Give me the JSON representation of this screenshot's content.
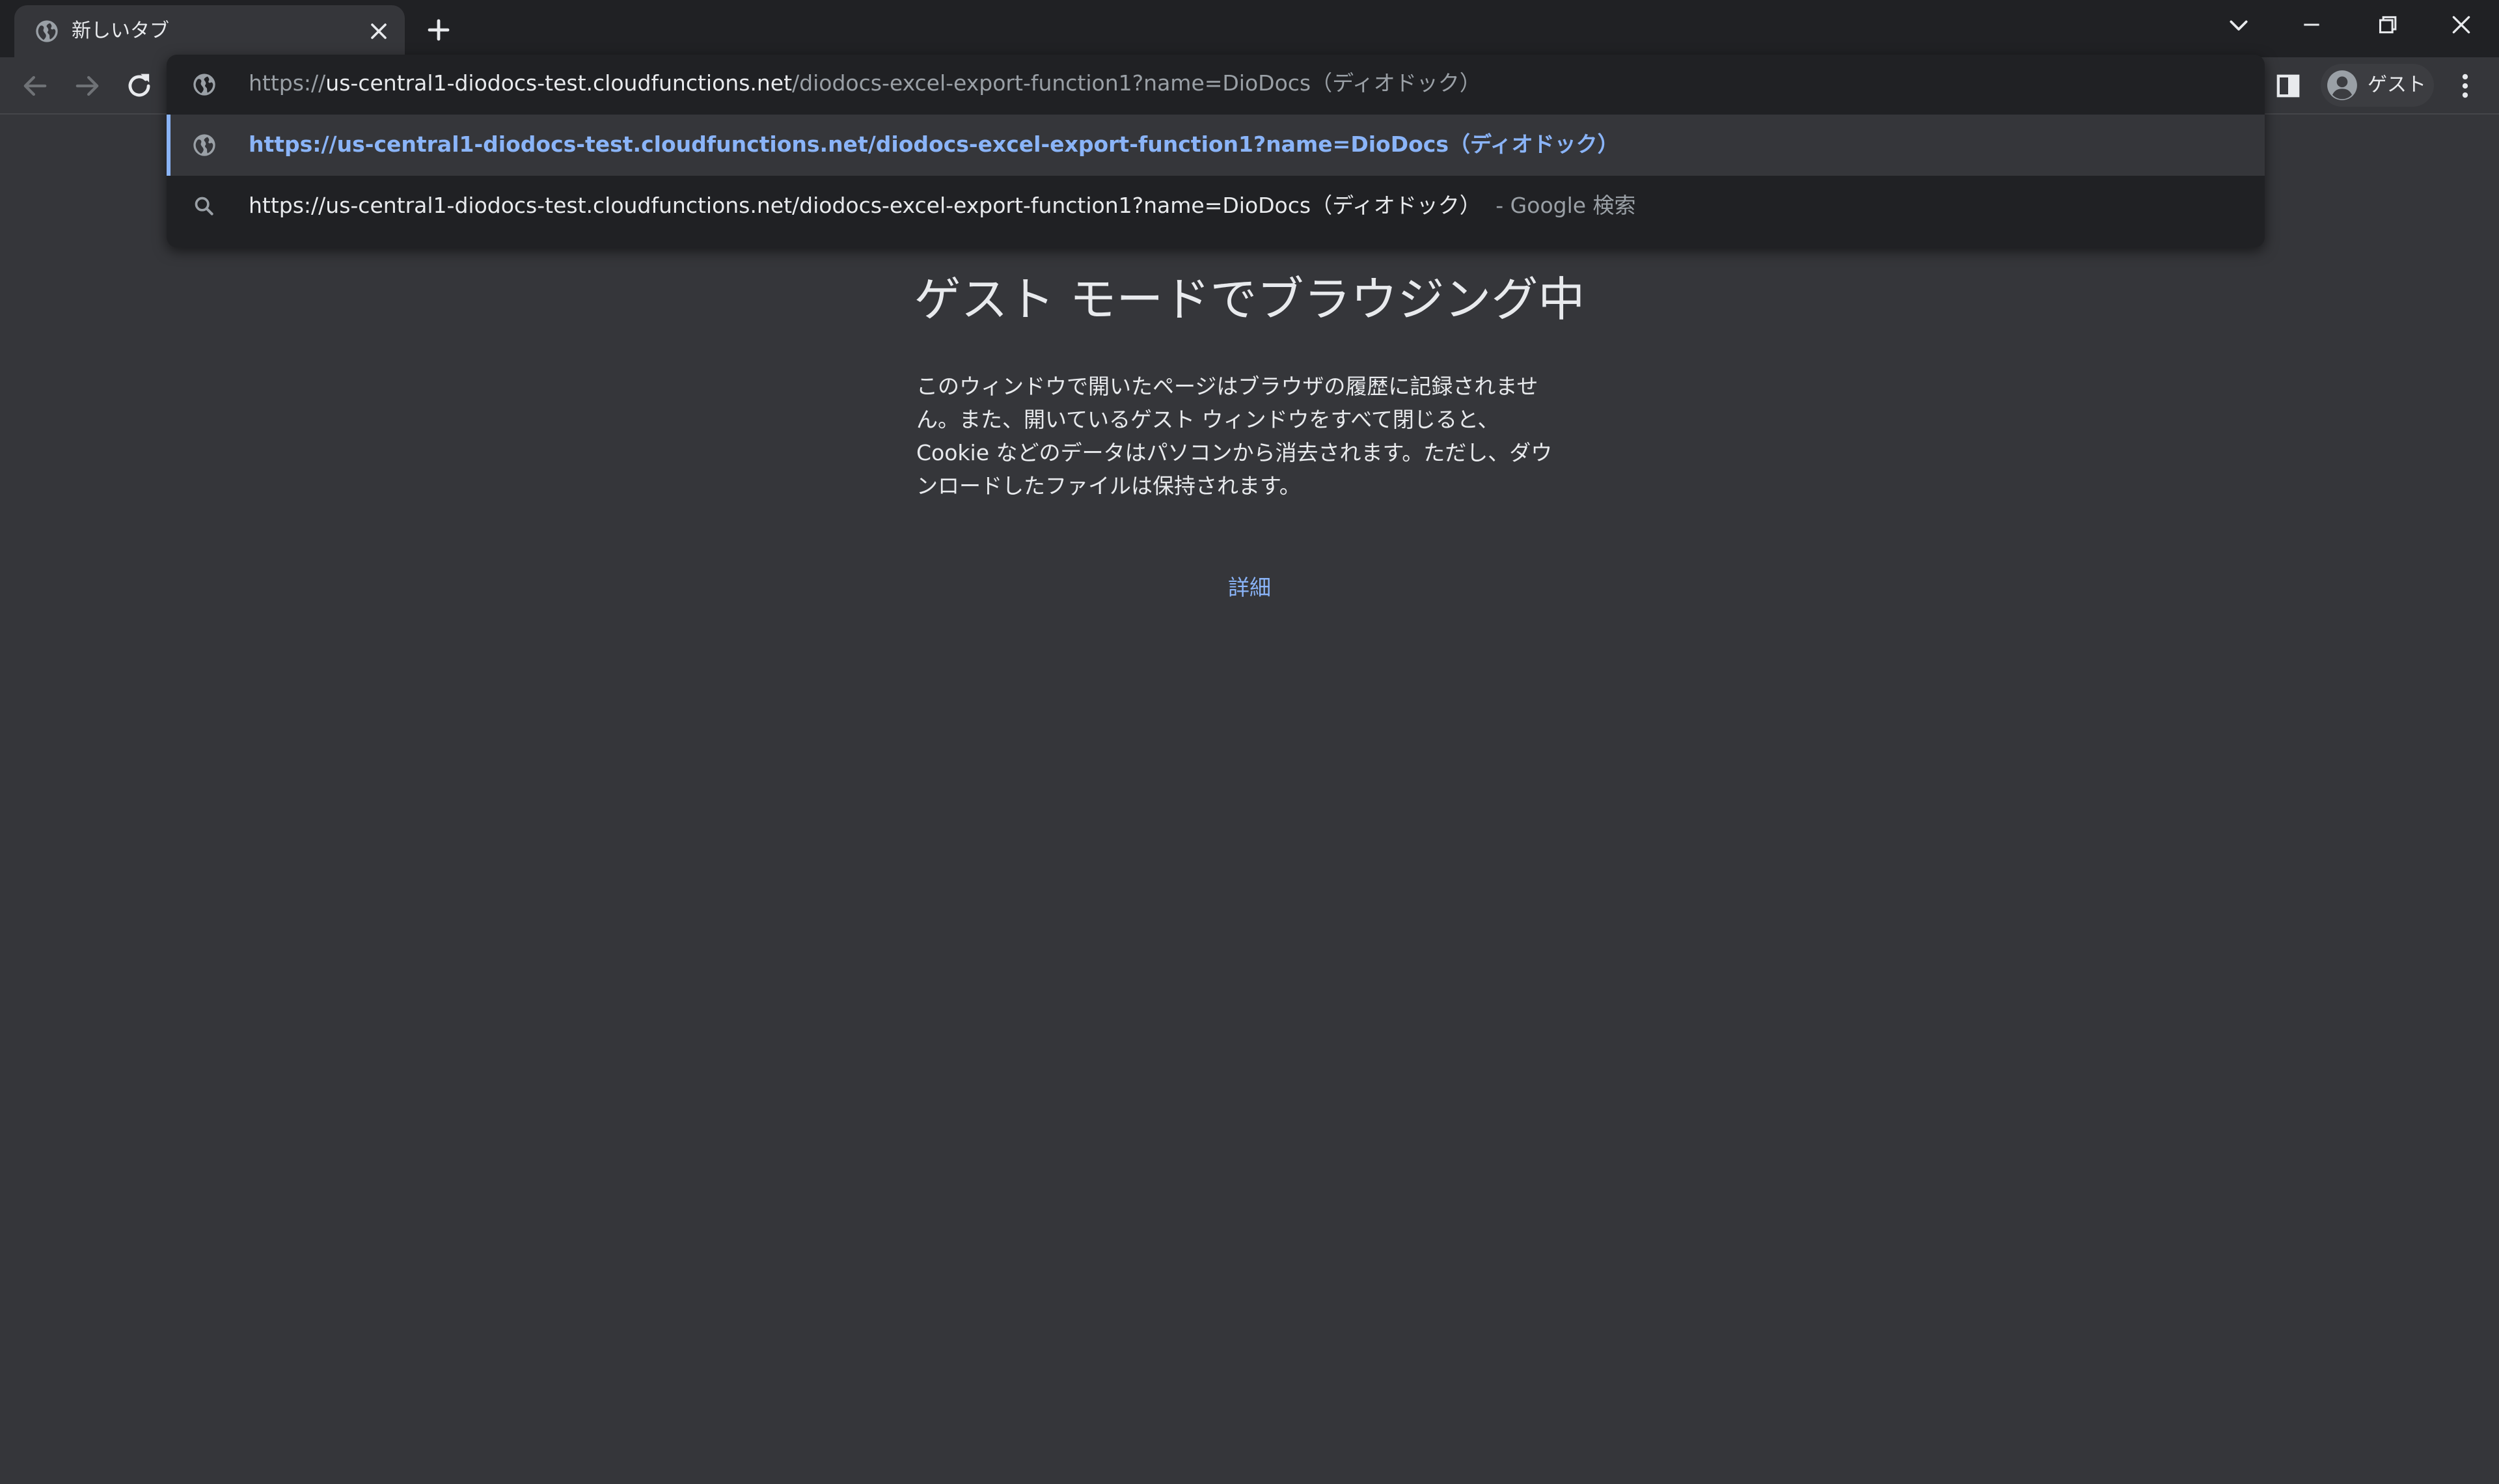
{
  "tab": {
    "title": "新しいタブ"
  },
  "omnibox": {
    "input": {
      "scheme": "https://",
      "host": "us-central1-diodocs-test.cloudfunctions.net",
      "path": "/diodocs-excel-export-function1?name=DioDocs（ディオドック）"
    },
    "suggestions": [
      {
        "icon": "globe-icon",
        "text": "https://us-central1-diodocs-test.cloudfunctions.net/diodocs-excel-export-function1?name=DioDocs（ディオドック）",
        "selected": true
      },
      {
        "icon": "search-icon",
        "text": "https://us-central1-diodocs-test.cloudfunctions.net/diodocs-excel-export-function1?name=DioDocs（ディオドック）",
        "suffix": "- Google 検索",
        "selected": false
      }
    ]
  },
  "profile": {
    "label": "ゲスト"
  },
  "page": {
    "heading": "ゲスト モードでブラウジング中",
    "description": "このウィンドウで開いたページはブラウザの履歴に記録されません。また、開いているゲスト ウィンドウをすべて閉じると、Cookie などのデータはパソコンから消去されます。ただし、ダウンロードしたファイルは保持されます。",
    "learn_more": "詳細"
  },
  "colors": {
    "tabstrip_bg": "#202124",
    "page_bg": "#35363a",
    "text": "#e8eaed",
    "muted_text": "#9aa0a6",
    "accent": "#8ab4f8"
  },
  "icons": {
    "tab_favicon": "globe-icon",
    "tab_close": "close-icon",
    "new_tab": "plus-icon",
    "tab_search": "chevron-down-icon",
    "minimize": "minimize-icon",
    "restore": "restore-icon",
    "close_window": "close-icon",
    "back": "arrow-left-icon",
    "forward": "arrow-right-icon",
    "reload": "reload-icon",
    "side_panel": "side-panel-icon",
    "avatar": "person-icon",
    "menu": "more-vert-icon"
  }
}
